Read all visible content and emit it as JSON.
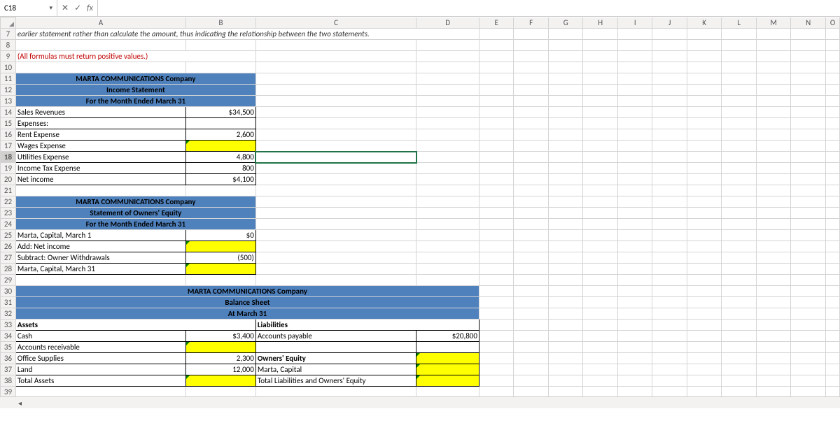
{
  "namebox": "C18",
  "fb": {
    "cancel": "✕",
    "confirm": "✓",
    "fx": "fx"
  },
  "cols": [
    "A",
    "B",
    "C",
    "D",
    "E",
    "F",
    "G",
    "H",
    "I",
    "J",
    "K",
    "L",
    "M",
    "N",
    "O"
  ],
  "rows": {
    "r7": "earlier statement rather than calculate the amount, thus indicating the relationship between the two statements.",
    "r9": "(All formulas must return positive values.)",
    "r11": "MARTA COMMUNICATIONS Company",
    "r12": "Income Statement",
    "r13": "For the Month Ended  March 31",
    "r14a": "Sales Revenues",
    "r14b": "$34,500",
    "r15a": "Expenses:",
    "r16a": "   Rent Expense",
    "r16b": "2,600",
    "r17a": "   Wages Expense",
    "r18a": "   Utilities Expense",
    "r18b": "4,800",
    "r19a": "   Income Tax Expense",
    "r19b": "800",
    "r20a": "Net income",
    "r20b": "$4,100",
    "r22": "MARTA COMMUNICATIONS Company",
    "r23": "Statement of Owners' Equity",
    "r24": "For the Month Ended  March 31",
    "r25a": "Marta, Capital, March 1",
    "r25b": "$0",
    "r26a": "   Add: Net income",
    "r27a": "   Subtract: Owner Withdrawals",
    "r27b": "(500)",
    "r28a": "Marta, Capital, March 31",
    "r30": "MARTA COMMUNICATIONS Company",
    "r31": "Balance Sheet",
    "r32": "At March 31",
    "r33a": "Assets",
    "r33c": "Liabilities",
    "r34a": "   Cash",
    "r34b": "$3,400",
    "r34c": "   Accounts payable",
    "r34d": "$20,800",
    "r35a": "   Accounts receivable",
    "r36a": "   Office Supplies",
    "r36b": "2,300",
    "r36c": "Owners' Equity",
    "r37a": "   Land",
    "r37b": "12,000",
    "r37c": "   Marta, Capital",
    "r38a": "Total Assets",
    "r38c": "Total Liabilities and Owners' Equity"
  },
  "nav": "◂"
}
